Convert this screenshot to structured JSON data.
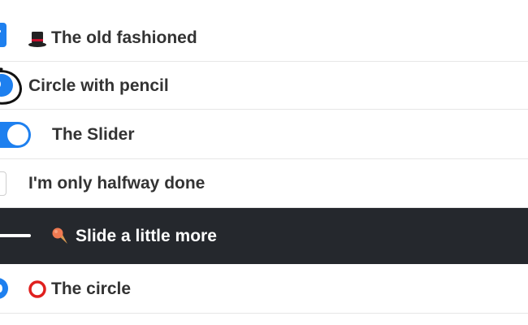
{
  "items": [
    {
      "label": "The old fashioned",
      "control": "checkbox",
      "checked": true,
      "icon": "top-hat-icon"
    },
    {
      "label": "Circle with pencil",
      "control": "radio-pencil",
      "checked": true
    },
    {
      "label": "The Slider",
      "control": "toggle",
      "checked": true
    },
    {
      "label": "I'm only halfway done",
      "control": "checkbox",
      "checked": false
    },
    {
      "label": "Slide a little more",
      "control": "slider",
      "icon": "ice-cream-cone-icon"
    },
    {
      "label": "The circle",
      "control": "radio",
      "checked": true,
      "icon": "hollow-red-circle-icon"
    }
  ],
  "colors": {
    "accent": "#1e80ef",
    "text": "#333333",
    "dark_row_bg": "#25282d",
    "divider": "#e6e6e6",
    "red_circle": "#e0201e"
  }
}
